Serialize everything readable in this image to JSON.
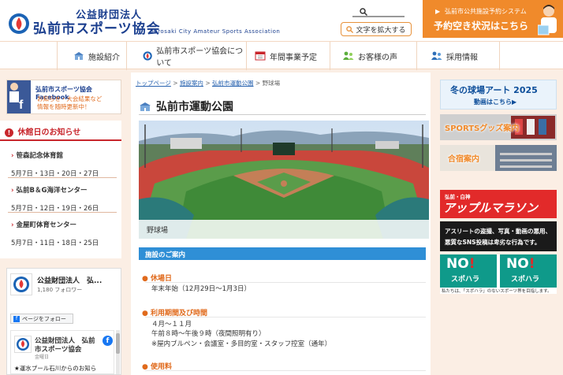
{
  "header": {
    "org_line1": "公益財団法人",
    "org_line2": "弘前市スポーツ協会",
    "org_en": "Hirosaki City Amateur Sports Association",
    "enlarge_label": "文字を拡大する",
    "reserve_line1": "弘前市公共施設予約システム",
    "reserve_line2": "予約空き状況はこちら",
    "reserve_arrow": "▶"
  },
  "nav": {
    "items": [
      {
        "label": "施設紹介"
      },
      {
        "label": "弘前市スポーツ協会について"
      },
      {
        "label": "年間事業予定"
      },
      {
        "label": "お客様の声"
      },
      {
        "label": "採用情報"
      }
    ]
  },
  "left": {
    "fb_banner_title": "弘前市スポーツ協会 Facebook",
    "fb_banner_sub1": "お知らせ・大会結果など",
    "fb_banner_sub2": "情報を随時更新中！",
    "holiday_title": "休館日のお知らせ",
    "holidays": [
      {
        "name": "笹森記念体育館",
        "dates": "5月7日・13日・20日・27日"
      },
      {
        "name": "弘前B＆G海洋センター",
        "dates": "5月7日・12日・19日・26日"
      },
      {
        "name": "金屋町体育センター",
        "dates": "5月7日・11日・18日・25日"
      }
    ],
    "fb_widget": {
      "name": "公益財団法人　弘...",
      "followers": "1,180 フォロワー",
      "follow_btn": "ページをフォロー",
      "post_name1": "公益財団法人　弘前",
      "post_name2": "市スポーツ協会",
      "post_date": "金曜日",
      "post_text": "★運水プール石川からのお知ら",
      "fb_letter": "f"
    }
  },
  "main": {
    "breadcrumb": [
      "トップページ",
      "施設案内",
      "弘前市運動公園",
      "野球場"
    ],
    "breadcrumb_sep": ">",
    "title": "弘前市運動公園",
    "caption": "野球場",
    "guide_title": "施設のご案内",
    "sections": [
      {
        "head": "休場日",
        "lines": [
          "年末年始（12月29日～1月3日）"
        ]
      },
      {
        "head": "利用期間及び時間",
        "lines": [
          "４月～１１月",
          "午前８時～午後９時（夜間照明有り）",
          "※屋内ブルペン・会議室・多目的室・スタッフ控室（通年）"
        ]
      },
      {
        "head": "使用料",
        "lines": []
      }
    ],
    "bullet": "●"
  },
  "right": {
    "winter_title": "冬の球場アート 2025",
    "winter_sub": "動画はこちら▶",
    "sports_goods": "SPORTSグッズ案内",
    "camp": "合宿案内",
    "apple_small": "弘前・白神",
    "apple_big": "アップルマラソン",
    "sns_line1": "アスリートの盗撮、写真・動画の悪用、",
    "sns_line2": "悪質なSNS投稿は卑劣な行為です。",
    "no_text": "NO",
    "no_mark": "!",
    "sukara": "スポハラ",
    "sukara_note": "私たちは、「スポハラ」のないスポーツ界を目指します。"
  }
}
